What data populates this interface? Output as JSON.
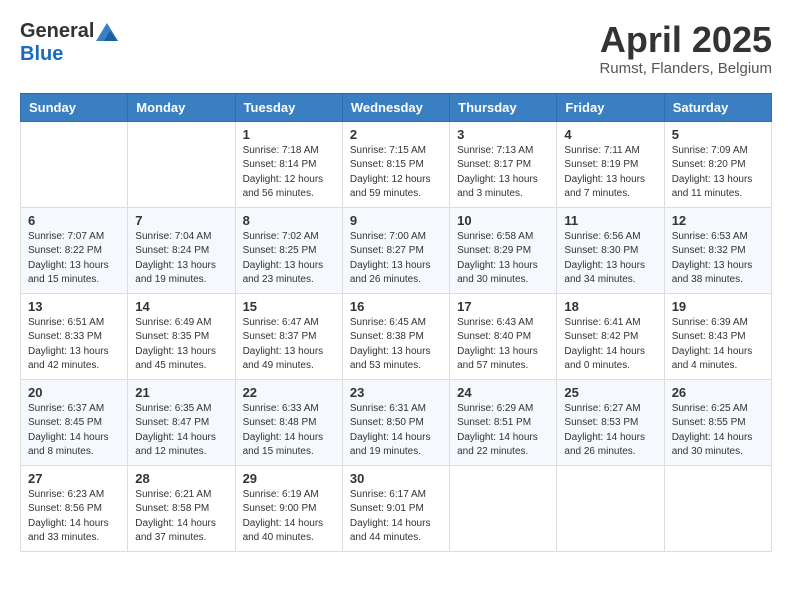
{
  "header": {
    "logo_general": "General",
    "logo_blue": "Blue",
    "month_title": "April 2025",
    "subtitle": "Rumst, Flanders, Belgium"
  },
  "days_of_week": [
    "Sunday",
    "Monday",
    "Tuesday",
    "Wednesday",
    "Thursday",
    "Friday",
    "Saturday"
  ],
  "weeks": [
    [
      {
        "day": "",
        "sunrise": "",
        "sunset": "",
        "daylight": ""
      },
      {
        "day": "",
        "sunrise": "",
        "sunset": "",
        "daylight": ""
      },
      {
        "day": "1",
        "sunrise": "Sunrise: 7:18 AM",
        "sunset": "Sunset: 8:14 PM",
        "daylight": "Daylight: 12 hours and 56 minutes."
      },
      {
        "day": "2",
        "sunrise": "Sunrise: 7:15 AM",
        "sunset": "Sunset: 8:15 PM",
        "daylight": "Daylight: 12 hours and 59 minutes."
      },
      {
        "day": "3",
        "sunrise": "Sunrise: 7:13 AM",
        "sunset": "Sunset: 8:17 PM",
        "daylight": "Daylight: 13 hours and 3 minutes."
      },
      {
        "day": "4",
        "sunrise": "Sunrise: 7:11 AM",
        "sunset": "Sunset: 8:19 PM",
        "daylight": "Daylight: 13 hours and 7 minutes."
      },
      {
        "day": "5",
        "sunrise": "Sunrise: 7:09 AM",
        "sunset": "Sunset: 8:20 PM",
        "daylight": "Daylight: 13 hours and 11 minutes."
      }
    ],
    [
      {
        "day": "6",
        "sunrise": "Sunrise: 7:07 AM",
        "sunset": "Sunset: 8:22 PM",
        "daylight": "Daylight: 13 hours and 15 minutes."
      },
      {
        "day": "7",
        "sunrise": "Sunrise: 7:04 AM",
        "sunset": "Sunset: 8:24 PM",
        "daylight": "Daylight: 13 hours and 19 minutes."
      },
      {
        "day": "8",
        "sunrise": "Sunrise: 7:02 AM",
        "sunset": "Sunset: 8:25 PM",
        "daylight": "Daylight: 13 hours and 23 minutes."
      },
      {
        "day": "9",
        "sunrise": "Sunrise: 7:00 AM",
        "sunset": "Sunset: 8:27 PM",
        "daylight": "Daylight: 13 hours and 26 minutes."
      },
      {
        "day": "10",
        "sunrise": "Sunrise: 6:58 AM",
        "sunset": "Sunset: 8:29 PM",
        "daylight": "Daylight: 13 hours and 30 minutes."
      },
      {
        "day": "11",
        "sunrise": "Sunrise: 6:56 AM",
        "sunset": "Sunset: 8:30 PM",
        "daylight": "Daylight: 13 hours and 34 minutes."
      },
      {
        "day": "12",
        "sunrise": "Sunrise: 6:53 AM",
        "sunset": "Sunset: 8:32 PM",
        "daylight": "Daylight: 13 hours and 38 minutes."
      }
    ],
    [
      {
        "day": "13",
        "sunrise": "Sunrise: 6:51 AM",
        "sunset": "Sunset: 8:33 PM",
        "daylight": "Daylight: 13 hours and 42 minutes."
      },
      {
        "day": "14",
        "sunrise": "Sunrise: 6:49 AM",
        "sunset": "Sunset: 8:35 PM",
        "daylight": "Daylight: 13 hours and 45 minutes."
      },
      {
        "day": "15",
        "sunrise": "Sunrise: 6:47 AM",
        "sunset": "Sunset: 8:37 PM",
        "daylight": "Daylight: 13 hours and 49 minutes."
      },
      {
        "day": "16",
        "sunrise": "Sunrise: 6:45 AM",
        "sunset": "Sunset: 8:38 PM",
        "daylight": "Daylight: 13 hours and 53 minutes."
      },
      {
        "day": "17",
        "sunrise": "Sunrise: 6:43 AM",
        "sunset": "Sunset: 8:40 PM",
        "daylight": "Daylight: 13 hours and 57 minutes."
      },
      {
        "day": "18",
        "sunrise": "Sunrise: 6:41 AM",
        "sunset": "Sunset: 8:42 PM",
        "daylight": "Daylight: 14 hours and 0 minutes."
      },
      {
        "day": "19",
        "sunrise": "Sunrise: 6:39 AM",
        "sunset": "Sunset: 8:43 PM",
        "daylight": "Daylight: 14 hours and 4 minutes."
      }
    ],
    [
      {
        "day": "20",
        "sunrise": "Sunrise: 6:37 AM",
        "sunset": "Sunset: 8:45 PM",
        "daylight": "Daylight: 14 hours and 8 minutes."
      },
      {
        "day": "21",
        "sunrise": "Sunrise: 6:35 AM",
        "sunset": "Sunset: 8:47 PM",
        "daylight": "Daylight: 14 hours and 12 minutes."
      },
      {
        "day": "22",
        "sunrise": "Sunrise: 6:33 AM",
        "sunset": "Sunset: 8:48 PM",
        "daylight": "Daylight: 14 hours and 15 minutes."
      },
      {
        "day": "23",
        "sunrise": "Sunrise: 6:31 AM",
        "sunset": "Sunset: 8:50 PM",
        "daylight": "Daylight: 14 hours and 19 minutes."
      },
      {
        "day": "24",
        "sunrise": "Sunrise: 6:29 AM",
        "sunset": "Sunset: 8:51 PM",
        "daylight": "Daylight: 14 hours and 22 minutes."
      },
      {
        "day": "25",
        "sunrise": "Sunrise: 6:27 AM",
        "sunset": "Sunset: 8:53 PM",
        "daylight": "Daylight: 14 hours and 26 minutes."
      },
      {
        "day": "26",
        "sunrise": "Sunrise: 6:25 AM",
        "sunset": "Sunset: 8:55 PM",
        "daylight": "Daylight: 14 hours and 30 minutes."
      }
    ],
    [
      {
        "day": "27",
        "sunrise": "Sunrise: 6:23 AM",
        "sunset": "Sunset: 8:56 PM",
        "daylight": "Daylight: 14 hours and 33 minutes."
      },
      {
        "day": "28",
        "sunrise": "Sunrise: 6:21 AM",
        "sunset": "Sunset: 8:58 PM",
        "daylight": "Daylight: 14 hours and 37 minutes."
      },
      {
        "day": "29",
        "sunrise": "Sunrise: 6:19 AM",
        "sunset": "Sunset: 9:00 PM",
        "daylight": "Daylight: 14 hours and 40 minutes."
      },
      {
        "day": "30",
        "sunrise": "Sunrise: 6:17 AM",
        "sunset": "Sunset: 9:01 PM",
        "daylight": "Daylight: 14 hours and 44 minutes."
      },
      {
        "day": "",
        "sunrise": "",
        "sunset": "",
        "daylight": ""
      },
      {
        "day": "",
        "sunrise": "",
        "sunset": "",
        "daylight": ""
      },
      {
        "day": "",
        "sunrise": "",
        "sunset": "",
        "daylight": ""
      }
    ]
  ]
}
